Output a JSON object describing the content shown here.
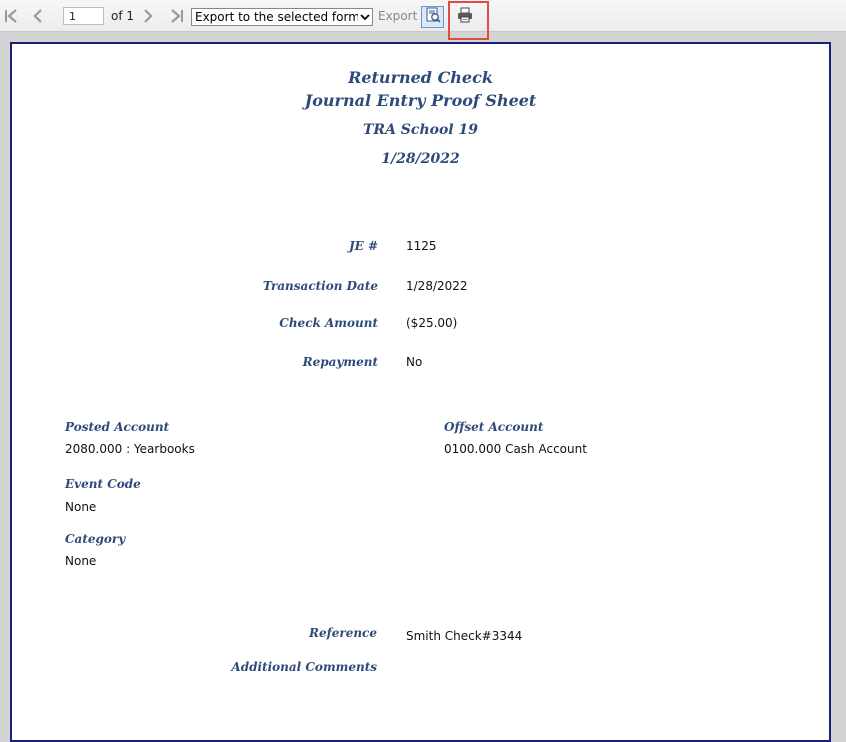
{
  "toolbar": {
    "page_number": "1",
    "of_label": "of 1",
    "export_format": "Export to the selected format",
    "export_label": "Export",
    "icons": [
      "first-page-icon",
      "previous-page-icon",
      "next-page-icon",
      "last-page-icon",
      "page-layout-icon",
      "print-icon"
    ]
  },
  "report": {
    "title_line1": "Returned Check",
    "title_line2": "Journal Entry Proof Sheet",
    "school": "TRA School 19",
    "date": "1/28/2022",
    "je_label": "JE #",
    "je_value": "1125",
    "transaction_date_label": "Transaction Date",
    "transaction_date_value": "1/28/2022",
    "check_amount_label": "Check Amount",
    "check_amount_value": "($25.00)",
    "repayment_label": "Repayment",
    "repayment_value": "No",
    "posted_account_label": "Posted Account",
    "posted_account_value": "2080.000 : Yearbooks",
    "offset_account_label": "Offset Account",
    "offset_account_value": "0100.000 Cash Account",
    "event_code_label": "Event Code",
    "event_code_value": "None",
    "category_label": "Category",
    "category_value": "None",
    "reference_label": "Reference",
    "reference_value": "Smith Check#3344",
    "additional_comments_label": "Additional Comments"
  },
  "colors": {
    "label_blue": "#2e4a7a",
    "page_border": "#1a1f7a",
    "highlight_red": "#e04c45"
  }
}
